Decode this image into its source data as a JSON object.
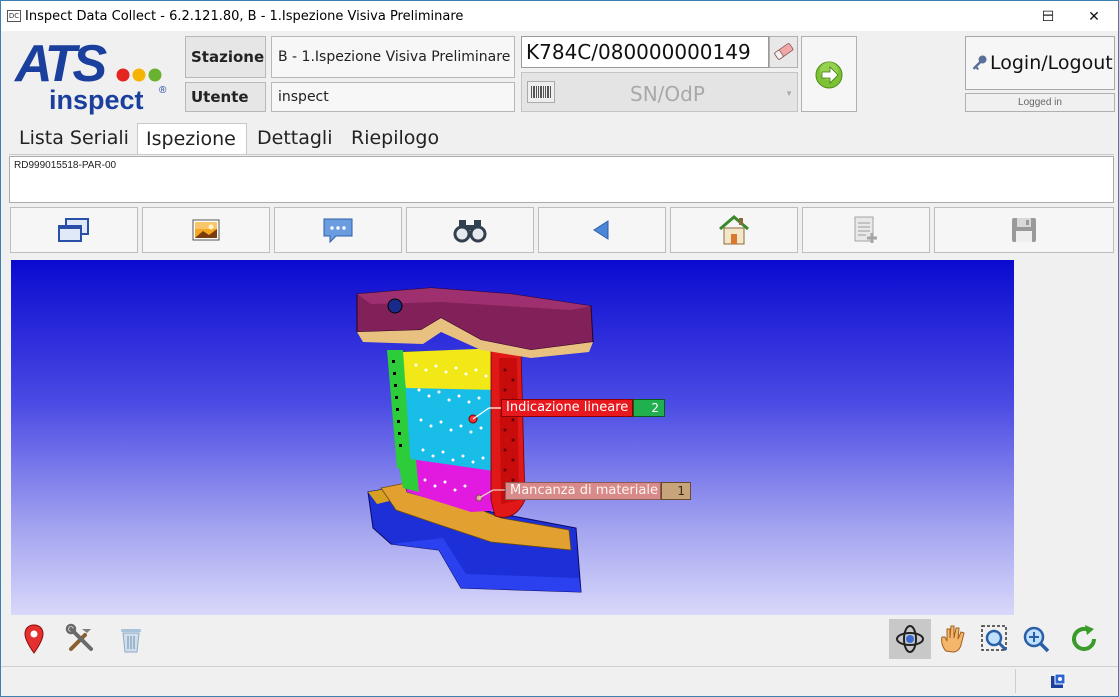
{
  "window": {
    "app_icon_text": "DC",
    "title": "Inspect Data Collect - 6.2.121.80, B - 1.Ispezione Visiva Preliminare",
    "minimize_glyph": "─",
    "maximize_glyph": "☐",
    "close_glyph": "✕"
  },
  "logo": {
    "brand": "ATS",
    "sub": "inspect",
    "registered": "®"
  },
  "header": {
    "station_label": "Stazione",
    "station_value": "B - 1.Ispezione Visiva Preliminare",
    "user_label": "Utente",
    "user_value": "inspect",
    "serial_value": "K784C/080000000149",
    "sn_placeholder": "SN/OdP",
    "login_label": "Login/Logout",
    "logged_in_text": "Logged in"
  },
  "tabs": [
    {
      "label": "Lista Seriali",
      "active": false
    },
    {
      "label": "Ispezione",
      "active": true
    },
    {
      "label": "Dettagli",
      "active": false
    },
    {
      "label": "Riepilogo",
      "active": false
    }
  ],
  "serial_box": {
    "text": "RD999015518-PAR-00"
  },
  "toolbar": [
    {
      "icon": "windows-icon",
      "enabled": true
    },
    {
      "icon": "image-icon",
      "enabled": true
    },
    {
      "icon": "comment-icon",
      "enabled": true
    },
    {
      "icon": "binoculars-icon",
      "enabled": true
    },
    {
      "icon": "back-arrow-icon",
      "enabled": true
    },
    {
      "icon": "home-icon",
      "enabled": true
    },
    {
      "icon": "add-document-icon",
      "enabled": false
    },
    {
      "icon": "save-icon",
      "enabled": false
    }
  ],
  "viewport": {
    "annotations": [
      {
        "label": "Indicazione lineare",
        "count": "2",
        "color": "#e8191e",
        "count_color": "#20b050"
      },
      {
        "label": "Mancanza di materiale",
        "count": "1",
        "color": "#d88a8a",
        "count_color": "#c8a47a"
      }
    ]
  },
  "bottom_tools_left": [
    "pin-icon",
    "tools-icon",
    "trash-icon"
  ],
  "bottom_tools_right": [
    "rotate-3d-icon",
    "pan-hand-icon",
    "zoom-window-icon",
    "zoom-icon",
    "refresh-icon"
  ],
  "colors": {
    "accent_blue": "#1b3f9c",
    "viewport_top": "#0a0ad0",
    "viewport_bottom": "#d8d8fa"
  }
}
